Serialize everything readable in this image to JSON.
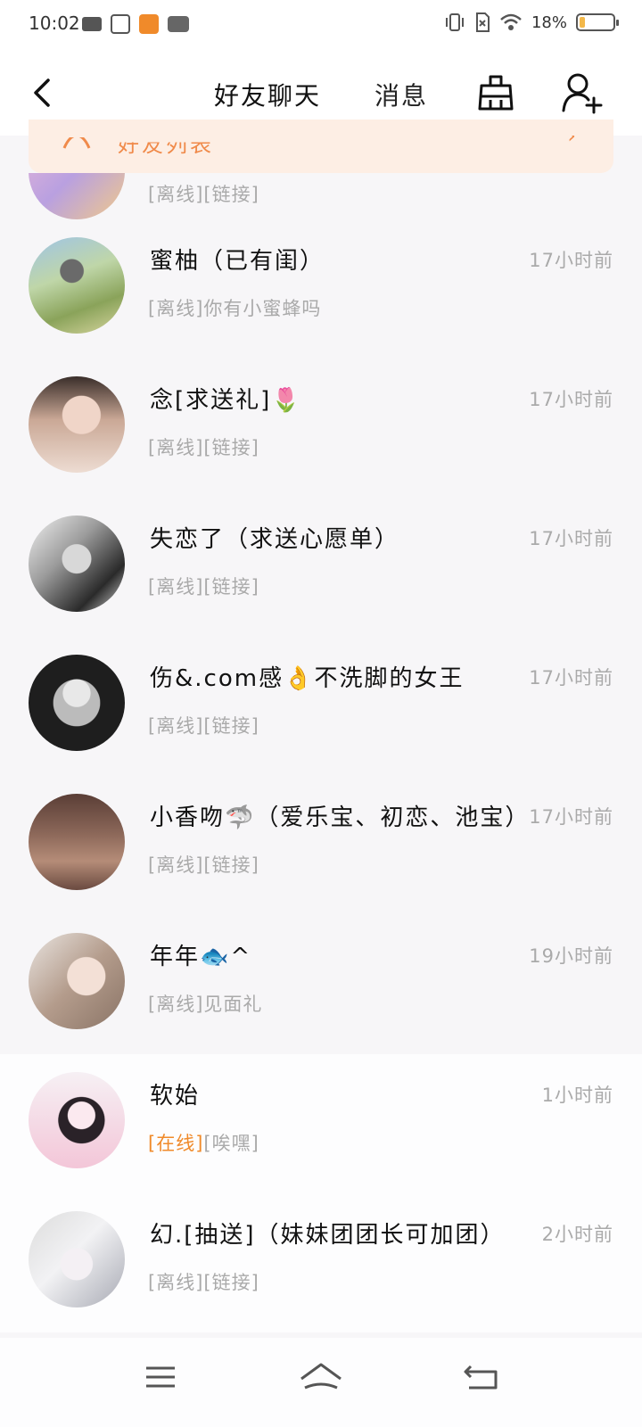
{
  "status_bar": {
    "time": "10:02",
    "battery_percent": "18%",
    "battery_level": 0.18,
    "icons": [
      "video-camera-icon",
      "screenshot-icon",
      "app-notification-icon",
      "vivo-icon",
      "vibrate-icon",
      "no-sim-icon",
      "wifi-icon",
      "battery-icon"
    ]
  },
  "header": {
    "tabs": [
      {
        "label": "好友聊天",
        "active": true
      },
      {
        "label": "消息",
        "active": false
      }
    ],
    "icons": [
      "back-arrow-icon",
      "broom-clean-icon",
      "add-friend-icon"
    ],
    "accent_color": "#f26b1d"
  },
  "friend_card": {
    "label": "好友列表"
  },
  "chats": [
    {
      "name": "",
      "status": "[离线][链接]",
      "time": "",
      "online": false,
      "partial": true
    },
    {
      "name": "蜜柚（已有闺）",
      "status": "[离线]你有小蜜蜂吗",
      "time": "17小时前",
      "online": false
    },
    {
      "name": "念[求送礼]🌷",
      "status": "[离线][链接]",
      "time": "17小时前",
      "online": false
    },
    {
      "name": "失恋了（求送心愿单）",
      "status": "[离线][链接]",
      "time": "17小时前",
      "online": false
    },
    {
      "name": "伤&.com感👌不洗脚的女王",
      "status": "[离线][链接]",
      "time": "17小时前",
      "online": false
    },
    {
      "name": "小香吻🦈（爱乐宝、初恋、池宝）",
      "status": "[离线][链接]",
      "time": "17小时前",
      "online": false
    },
    {
      "name": "年年🐟^",
      "status": "[离线]见面礼",
      "time": "19小时前",
      "online": false
    },
    {
      "name": "软始",
      "status_tag": "[在线]",
      "status": "[唉嘿]",
      "time": "1小时前",
      "online": true
    },
    {
      "name": "幻.[抽送]（妹妹团团长可加团）",
      "status": "[离线][链接]",
      "time": "2小时前",
      "online": false
    }
  ],
  "bottom_nav": {
    "icons": [
      "menu-icon",
      "home-icon",
      "back-icon"
    ]
  }
}
